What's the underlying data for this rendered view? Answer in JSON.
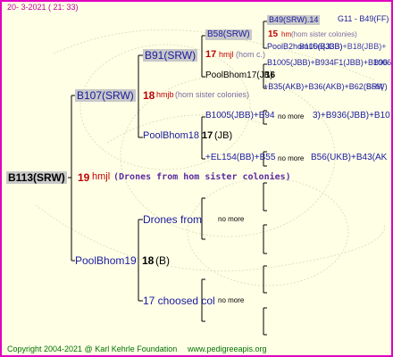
{
  "header": {
    "date": "20- 3-2021 ( 21: 33)"
  },
  "top_right": {
    "ref": "G11 - B49(FF)"
  },
  "root": {
    "label": "B113(SRW)",
    "year": "19",
    "breeder": "hmjl",
    "note": "(Drones from hom sister colonies)"
  },
  "mother": {
    "label": "B107(SRW)",
    "year": "18",
    "breeder": "hmjb",
    "note": "(hom sister colonies)"
  },
  "mm": {
    "label": "B91(SRW)",
    "year": "17",
    "breeder": "hmjl",
    "note": "(hom c.)"
  },
  "mmm": {
    "label": "B58(SRW)",
    "year": "15",
    "breeder": "hm",
    "note": "(hom sister colonies)"
  },
  "mmmm": {
    "label": "B49(SRW).14"
  },
  "mmmd": {
    "label": "PoolB2hom15(B33B)",
    "overlap": "B1006(JBB)+B18(JBB)+"
  },
  "mmd": {
    "label": "PoolBhom17(JB)",
    "year": "16"
  },
  "mmdm": {
    "label": "B1005(JBB)+B934F1(JBB)+B1006",
    "overlap": "B96"
  },
  "mmdd": {
    "label": "+B35(AKB)+B36(AKB)+B62(SRW)",
    "overlap": "B56("
  },
  "md": {
    "label": "PoolBhom18",
    "year": "17",
    "suffix": "(JB)"
  },
  "mdm": {
    "label": "B1005(JBB)+B94",
    "mid": "no more",
    "tail": "3)+B936(JBB)+B10"
  },
  "mdd": {
    "label": "+EL154(BB)+B55",
    "mid": "no more",
    "tail": "B56(UKB)+B43(AK"
  },
  "father": {
    "label": "PoolBhom19",
    "year": "18",
    "suffix": "(B)"
  },
  "fm": {
    "label": "Drones from",
    "note": "no more"
  },
  "fd": {
    "label": "17 choosed col",
    "note": "no more"
  },
  "footer": {
    "copyright": "Copyright 2004-2021 @ Karl Kehrle Foundation",
    "url": "www.pedigreeapis.org"
  },
  "colors": {
    "border": "#e000c0",
    "background": "#ffffe6",
    "box": "#c8c8c8",
    "text_blue": "#1a1aa0",
    "year_red": "#c00000",
    "footer_green": "#007000"
  }
}
